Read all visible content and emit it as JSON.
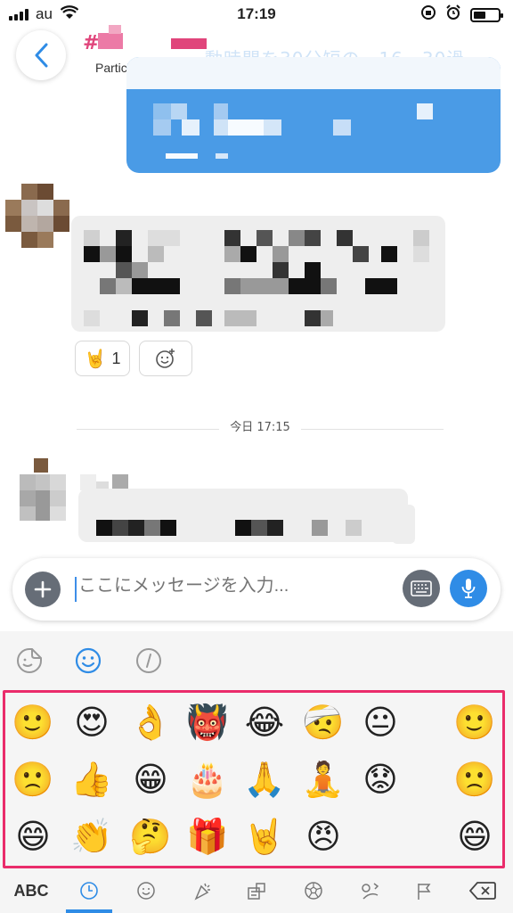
{
  "status_bar": {
    "carrier": "au",
    "time": "17:19"
  },
  "header": {
    "channel_prefix": "#",
    "participants_label": "Participants",
    "overlay_text": "動時間を30分短の、16　30過"
  },
  "reactions": [
    {
      "emoji": "🤘",
      "count": "1"
    },
    {
      "emoji": "add-reaction"
    }
  ],
  "date_divider": "今日 17:15",
  "composer": {
    "placeholder": "ここにメッセージを入力..."
  },
  "emoji_panel": {
    "top_tabs": [
      "sticker-icon",
      "emoji-icon",
      "slash-command-icon"
    ],
    "grid": [
      [
        "🙂",
        "😍",
        "👌",
        "👹",
        "😂",
        "🤕",
        "😐",
        "",
        "🙂"
      ],
      [
        "🙁",
        "👍",
        "😁",
        "🎂",
        "🙏",
        "🧘",
        "😟",
        "",
        "🙁"
      ],
      [
        "😄",
        "👏",
        "🤔",
        "🎁",
        "🤘",
        "😠",
        "",
        "",
        "😄"
      ]
    ],
    "bottom_categories": {
      "abc_label": "ABC",
      "items": [
        "recent-icon",
        "smiley-icon",
        "party-icon",
        "objects-icon",
        "ball-icon",
        "travel-icon",
        "flag-icon",
        "delete-icon"
      ]
    }
  },
  "colors": {
    "accent_blue": "#2f8ce6",
    "outgoing_bubble": "#4a9be6",
    "highlight_border": "#ea2c6b",
    "channel_pink": "#e0457b"
  }
}
